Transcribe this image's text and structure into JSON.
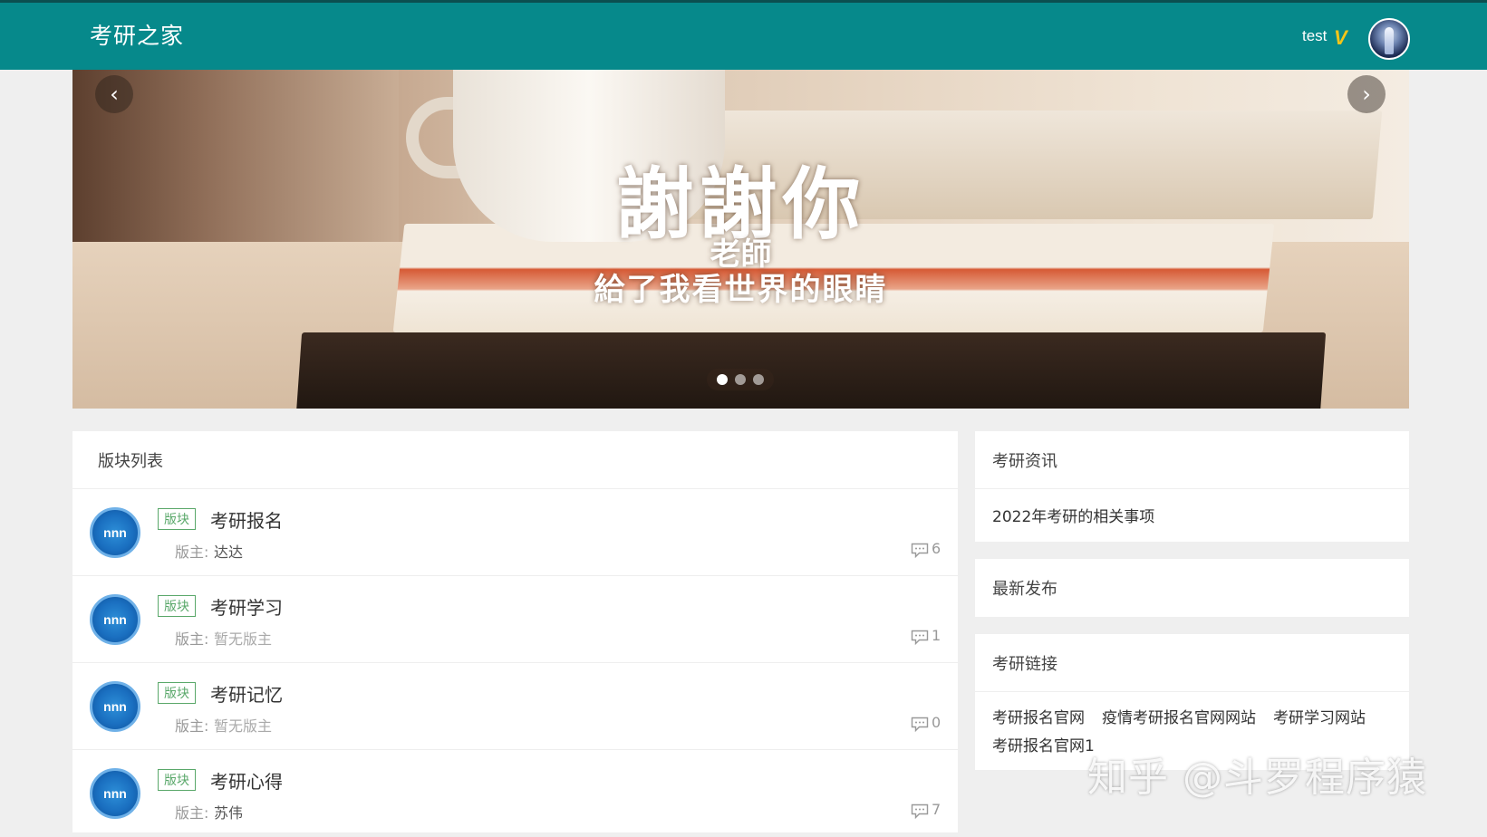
{
  "header": {
    "brand": "考研之家",
    "username": "test",
    "vip_badge": "V",
    "colors": {
      "bar": "#06898b",
      "vip": "#f5c518"
    }
  },
  "carousel": {
    "title": "謝謝你",
    "subtitle_line1": "老師",
    "subtitle_line2": "給了我看世界的眼睛",
    "prev_icon": "‹",
    "next_icon": "›",
    "slide_count": 3,
    "active_slide": 1
  },
  "boards": {
    "heading": "版块列表",
    "tag_label": "版块",
    "moderator_label": "版主:",
    "logo_text": "nnn",
    "items": [
      {
        "title": "考研报名",
        "moderator": "达达",
        "count": "6"
      },
      {
        "title": "考研学习",
        "moderator": "暂无版主",
        "count": "1"
      },
      {
        "title": "考研记忆",
        "moderator": "暂无版主",
        "count": "0"
      },
      {
        "title": "考研心得",
        "moderator": "苏伟",
        "count": "7"
      }
    ]
  },
  "sidebar": {
    "news": {
      "heading": "考研资讯",
      "items": [
        "2022年考研的相关事项"
      ]
    },
    "latest": {
      "heading": "最新发布"
    },
    "links": {
      "heading": "考研链接",
      "items": [
        "考研报名官网",
        "疫情考研报名官网网站",
        "考研学习网站",
        "考研报名官网1"
      ]
    }
  },
  "watermark": "知乎 @斗罗程序猿"
}
